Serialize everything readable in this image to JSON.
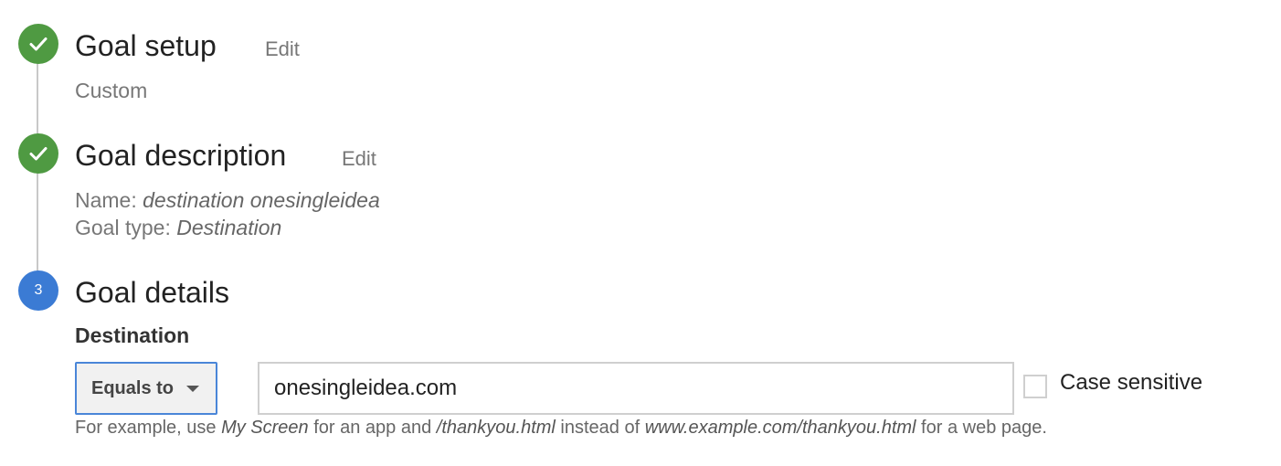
{
  "steps": [
    {
      "title": "Goal setup",
      "edit_label": "Edit",
      "summary": "Custom",
      "status": "complete"
    },
    {
      "title": "Goal description",
      "edit_label": "Edit",
      "name_label": "Name:",
      "name_value": "destination onesingleidea",
      "type_label": "Goal type:",
      "type_value": "Destination",
      "status": "complete"
    },
    {
      "title": "Goal details",
      "number": "3",
      "status": "current"
    }
  ],
  "destination": {
    "label": "Destination",
    "match_type": "Equals to",
    "value": "onesingleidea.com",
    "case_sensitive_label": "Case sensitive",
    "case_sensitive_checked": false
  },
  "hint": {
    "prefix": "For example, use ",
    "app_example": "My Screen",
    "mid1": " for an app and ",
    "path_example": "/thankyou.html",
    "mid2": " instead of ",
    "url_example": "www.example.com/thankyou.html",
    "suffix": " for a web page."
  },
  "colors": {
    "complete": "#4f9a42",
    "current": "#3b7bd4",
    "focus_border": "#4a86d8"
  },
  "icons": {
    "complete": "checkmark-icon",
    "dropdown": "caret-down-icon"
  }
}
